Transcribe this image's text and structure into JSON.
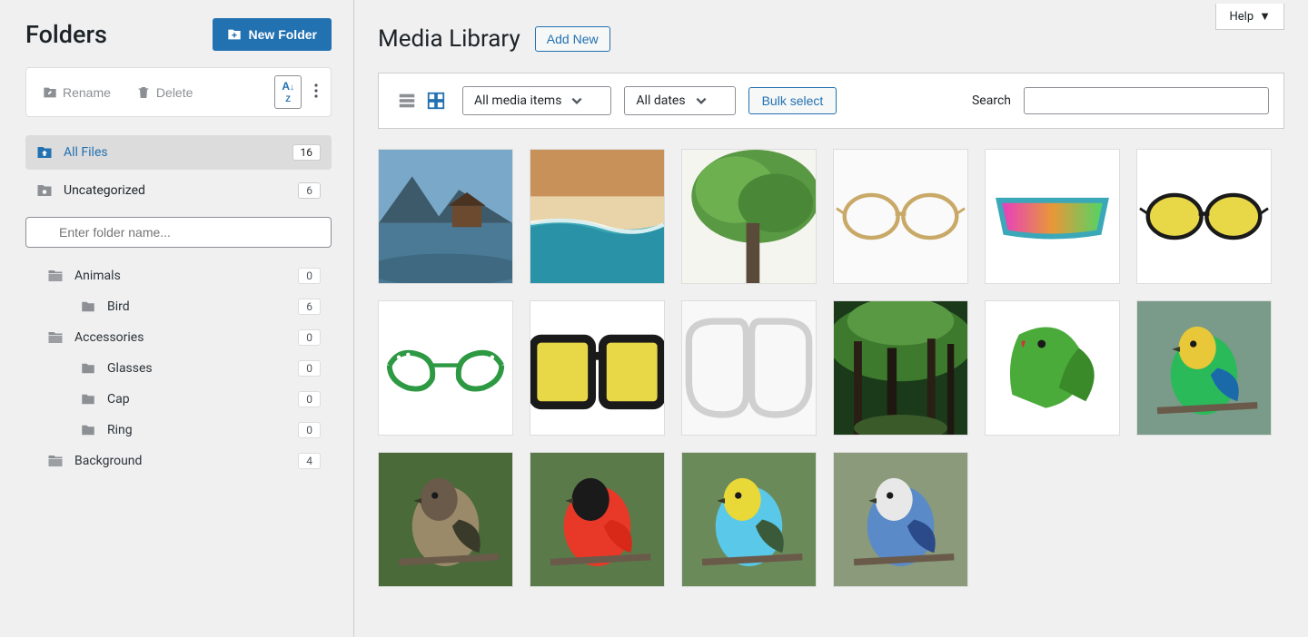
{
  "sidebar": {
    "title": "Folders",
    "new_folder_label": "New Folder",
    "rename_label": "Rename",
    "delete_label": "Delete",
    "sort_label": "A↓Z",
    "items": [
      {
        "label": "All Files",
        "count": "16",
        "active": true
      },
      {
        "label": "Uncategorized",
        "count": "6",
        "active": false
      }
    ],
    "search_placeholder": "Enter folder name...",
    "tree": [
      {
        "label": "Animals",
        "count": "0",
        "indent": 0,
        "icon": "folder"
      },
      {
        "label": "Bird",
        "count": "6",
        "indent": 1,
        "icon": "subfolder"
      },
      {
        "label": "Accessories",
        "count": "0",
        "indent": 0,
        "icon": "folder"
      },
      {
        "label": "Glasses",
        "count": "0",
        "indent": 1,
        "icon": "subfolder"
      },
      {
        "label": "Cap",
        "count": "0",
        "indent": 1,
        "icon": "subfolder"
      },
      {
        "label": "Ring",
        "count": "0",
        "indent": 1,
        "icon": "subfolder"
      },
      {
        "label": "Background",
        "count": "4",
        "indent": 0,
        "icon": "folder"
      }
    ]
  },
  "header": {
    "help_label": "Help",
    "page_title": "Media Library",
    "add_new_label": "Add New"
  },
  "filters": {
    "media_filter": "All media items",
    "date_filter": "All dates",
    "bulk_label": "Bulk select",
    "search_label": "Search"
  },
  "media": [
    {
      "name": "lake-cabin",
      "type": "landscape"
    },
    {
      "name": "beach-aerial",
      "type": "landscape"
    },
    {
      "name": "tree-canopy",
      "type": "landscape"
    },
    {
      "name": "round-glasses",
      "type": "glasses"
    },
    {
      "name": "sport-shades",
      "type": "glasses"
    },
    {
      "name": "yellow-oval-glasses",
      "type": "glasses"
    },
    {
      "name": "green-cateye-glasses",
      "type": "glasses"
    },
    {
      "name": "yellow-square-glasses",
      "type": "glasses"
    },
    {
      "name": "clear-glasses",
      "type": "glasses"
    },
    {
      "name": "forest-path",
      "type": "landscape"
    },
    {
      "name": "green-parrot",
      "type": "bird"
    },
    {
      "name": "green-tanager",
      "type": "bird"
    },
    {
      "name": "sparrow",
      "type": "bird"
    },
    {
      "name": "scarlet-tanager",
      "type": "bird"
    },
    {
      "name": "budgie",
      "type": "bird"
    },
    {
      "name": "blue-jay",
      "type": "bird"
    }
  ]
}
